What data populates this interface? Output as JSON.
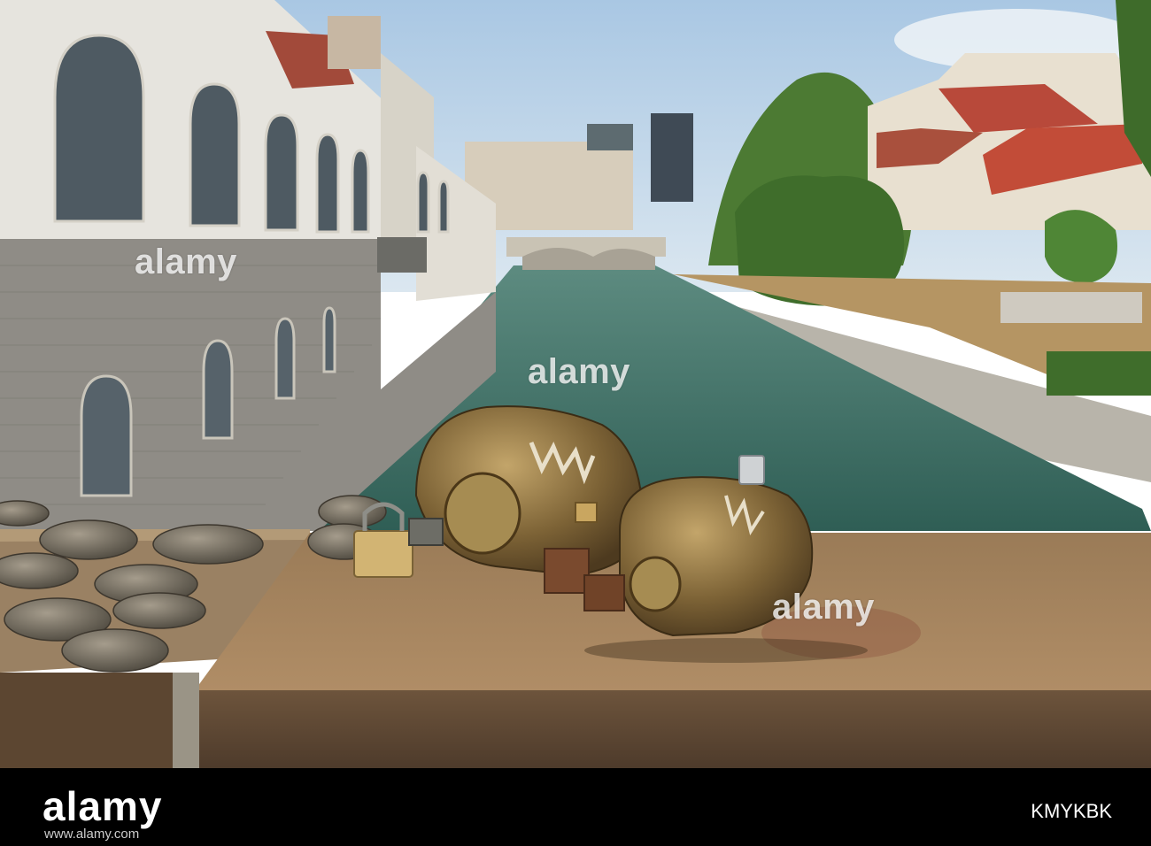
{
  "photo": {
    "subject": "bronze-sculpture-on-bridge-railing",
    "palette": {
      "sky": "#b9d2e8",
      "water": "#3f6e62",
      "stone_wall": "#8f8c86",
      "building_white": "#e6e4de",
      "roof_red": "#b8493a",
      "trees": "#4c7a33",
      "railing_bronze": "#8b6a48",
      "sculpture_bronze": "#7c6134"
    }
  },
  "watermarks": {
    "top": "alamy",
    "center": "alamy",
    "right": "alamy"
  },
  "footer": {
    "logo": "alamy",
    "image_id": "KMYKBK",
    "url": "www.alamy.com"
  }
}
